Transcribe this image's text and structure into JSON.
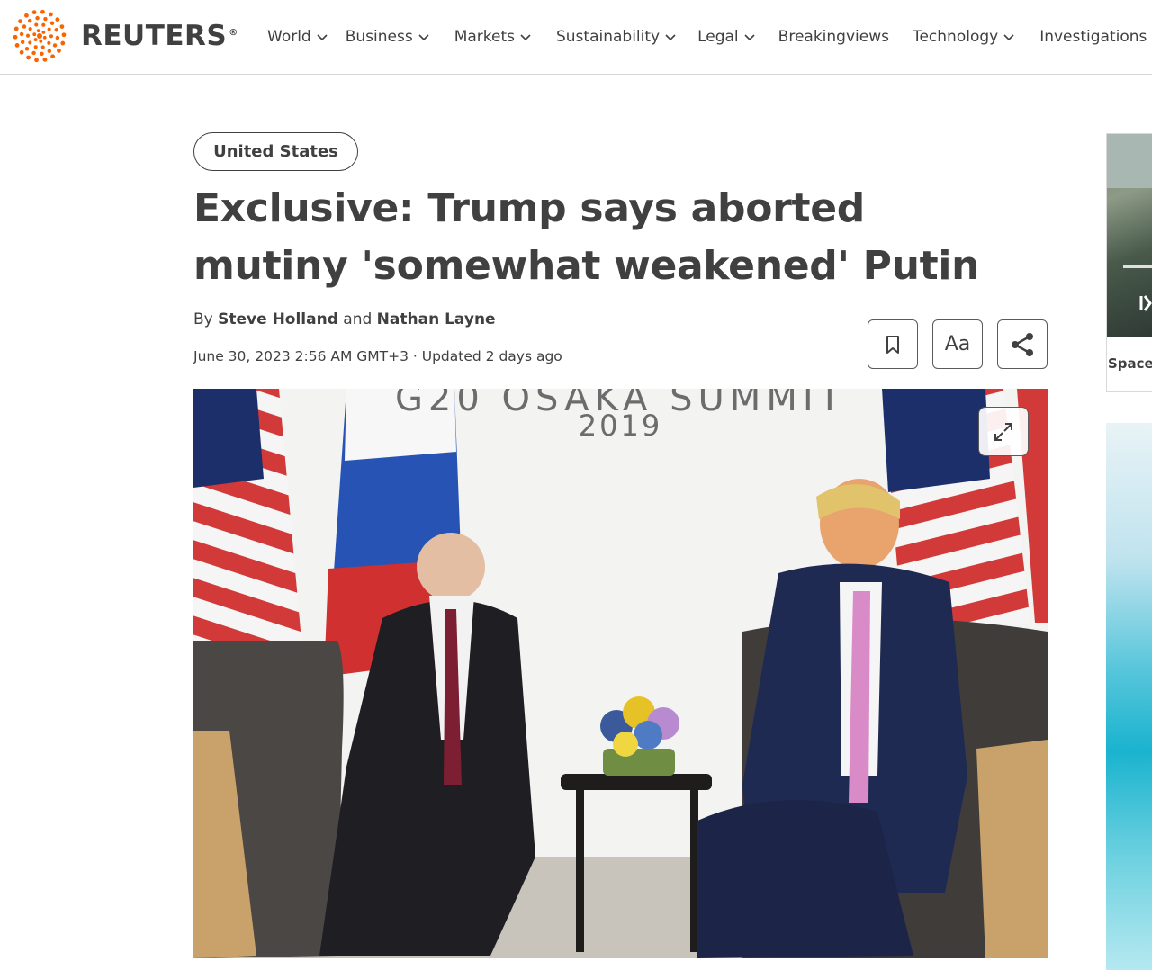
{
  "header": {
    "brand": "REUTERS",
    "brand_reg": "®",
    "nav": [
      {
        "label": "World",
        "dropdown": true
      },
      {
        "label": "Business",
        "dropdown": true
      },
      {
        "label": "Markets",
        "dropdown": true
      },
      {
        "label": "Sustainability",
        "dropdown": true
      },
      {
        "label": "Legal",
        "dropdown": true
      },
      {
        "label": "Breakingviews",
        "dropdown": false
      },
      {
        "label": "Technology",
        "dropdown": true
      },
      {
        "label": "Investigations",
        "dropdown": false
      }
    ]
  },
  "article": {
    "tag": "United States",
    "headline": "Exclusive: Trump says aborted mutiny 'somewhat weakened' Putin",
    "byline_prefix": "By",
    "author_1": "Steve Holland",
    "byline_and": "and",
    "author_2": "Nathan Layne",
    "dateline": "June 30, 2023 2:56 AM GMT+3 · Updated 2 days ago",
    "tools": {
      "bookmark_icon": "bookmark-icon",
      "text_size_label": "Aa",
      "share_icon": "share-icon"
    }
  },
  "photo": {
    "backdrop_text_top": "G20 OSAKA SUMMIT",
    "backdrop_text_year": "2019",
    "expand_icon": "expand-icon"
  },
  "rail": {
    "card_label": "Space"
  },
  "colors": {
    "brand_orange": "#fa6400",
    "text": "#404040",
    "border": "#d6d6d6"
  }
}
